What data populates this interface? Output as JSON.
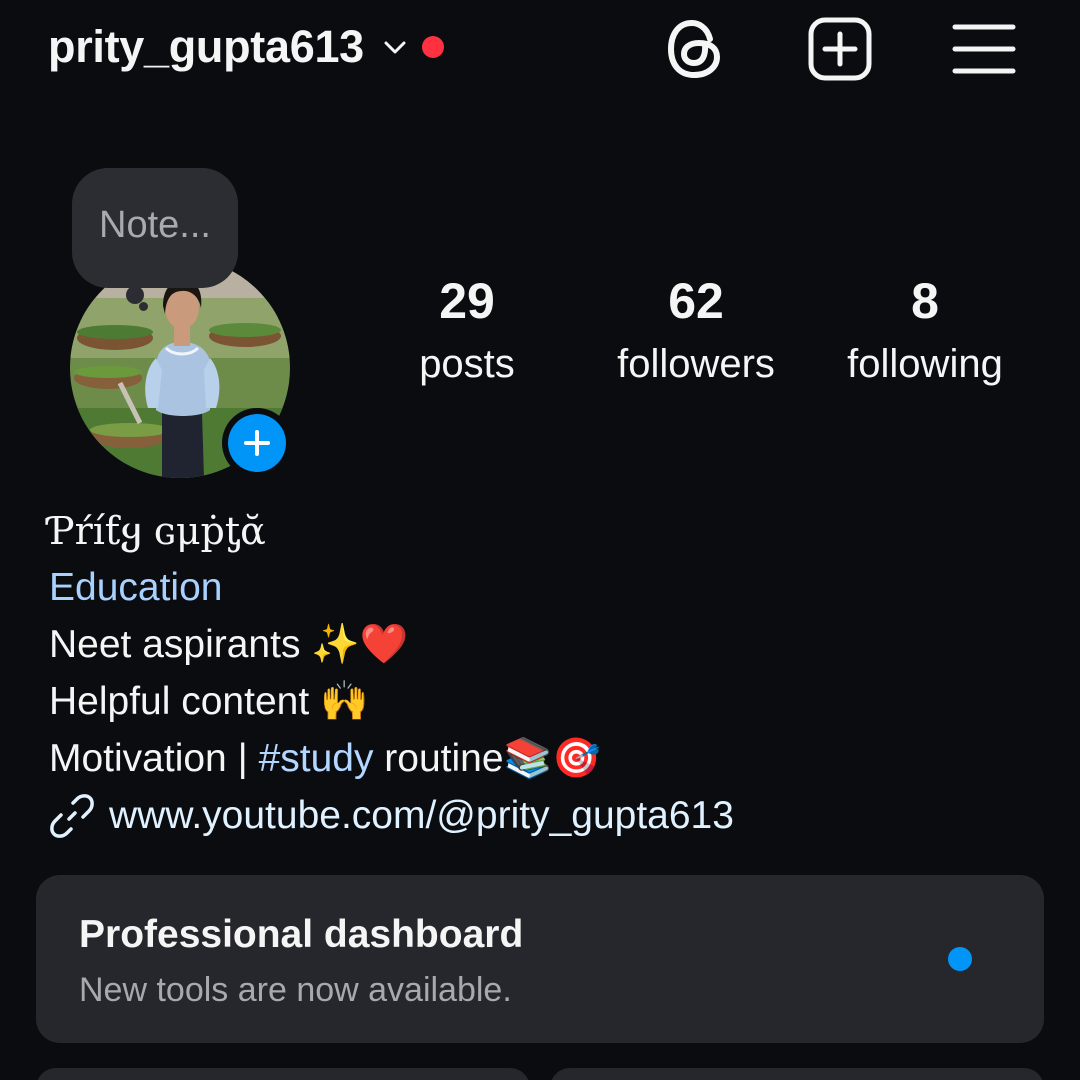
{
  "header": {
    "username": "prity_gupta613",
    "threads_icon": "threads-icon",
    "create_icon": "add-square-icon",
    "menu_icon": "hamburger-menu-icon"
  },
  "note": {
    "placeholder": "Note..."
  },
  "stats": {
    "posts": {
      "count": "29",
      "label": "posts"
    },
    "followers": {
      "count": "62",
      "label": "followers"
    },
    "following": {
      "count": "8",
      "label": "following"
    }
  },
  "bio": {
    "display_name": "Ƥŕíƭყ ɢμṗƫᾰ",
    "category": "Education",
    "line1": {
      "text": "Neet aspirants ",
      "emoji": "✨❤️"
    },
    "line2": {
      "text": "Helpful content ",
      "emoji": "🙌"
    },
    "line3": {
      "prefix": "Motivation | ",
      "hashtag": "#study",
      "suffix": " routine",
      "emoji": "📚🎯"
    },
    "link": "www.youtube.com/@prity_gupta613"
  },
  "dashboard": {
    "title": "Professional dashboard",
    "subtitle": "New tools are now available."
  },
  "colors": {
    "background": "#0b0c10",
    "text": "#f5f5f5",
    "accent_blue": "#0095f6",
    "link_blue": "#e0f1ff",
    "category_blue": "#a9d1ff",
    "hashtag_blue": "#b4d7ff",
    "notification_red": "#ff3040",
    "card_background": "#26272c"
  }
}
